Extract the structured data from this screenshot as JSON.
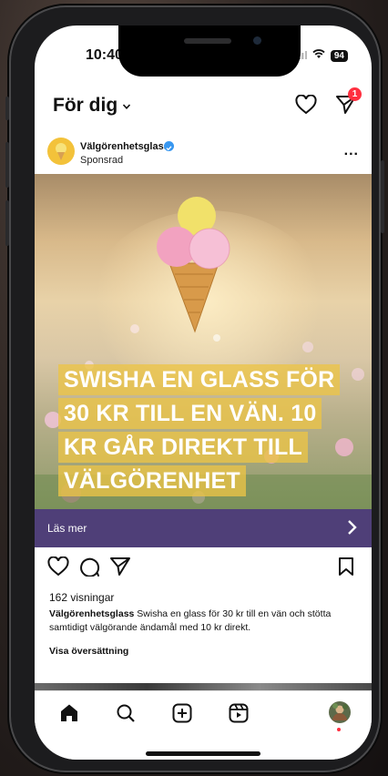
{
  "status": {
    "time": "10:40",
    "battery": "94"
  },
  "header": {
    "title": "För dig",
    "notification_count": "1"
  },
  "post": {
    "account": "Välgörenhetsglass",
    "sponsored_label": "Sponsrad",
    "more_label": "...",
    "ad_text_lines": [
      "SWISHA EN GLASS FÖR",
      "30 KR TILL EN VÄN. 10",
      "KR GÅR DIREKT TILL",
      "VÄLGÖRENHET"
    ],
    "cta_label": "Läs mer",
    "views": "162 visningar",
    "caption_text": "Swisha en glass för 30 kr till en vän och stötta samtidigt välgörande ändamål med 10 kr direkt.",
    "translate_label": "Visa översättning"
  },
  "icons": {
    "header": [
      "chevron-down-icon",
      "heart-icon",
      "send-icon"
    ],
    "actions": [
      "like-icon",
      "comment-icon",
      "share-icon",
      "bookmark-icon"
    ],
    "tabbar": [
      "home-icon",
      "search-icon",
      "create-icon",
      "reels-icon",
      "profile-avatar"
    ]
  },
  "colors": {
    "cta_background": "#4f3f78",
    "ad_text_highlight": "#ecc446",
    "badge": "#ff3040",
    "verified": "#3897f0"
  }
}
